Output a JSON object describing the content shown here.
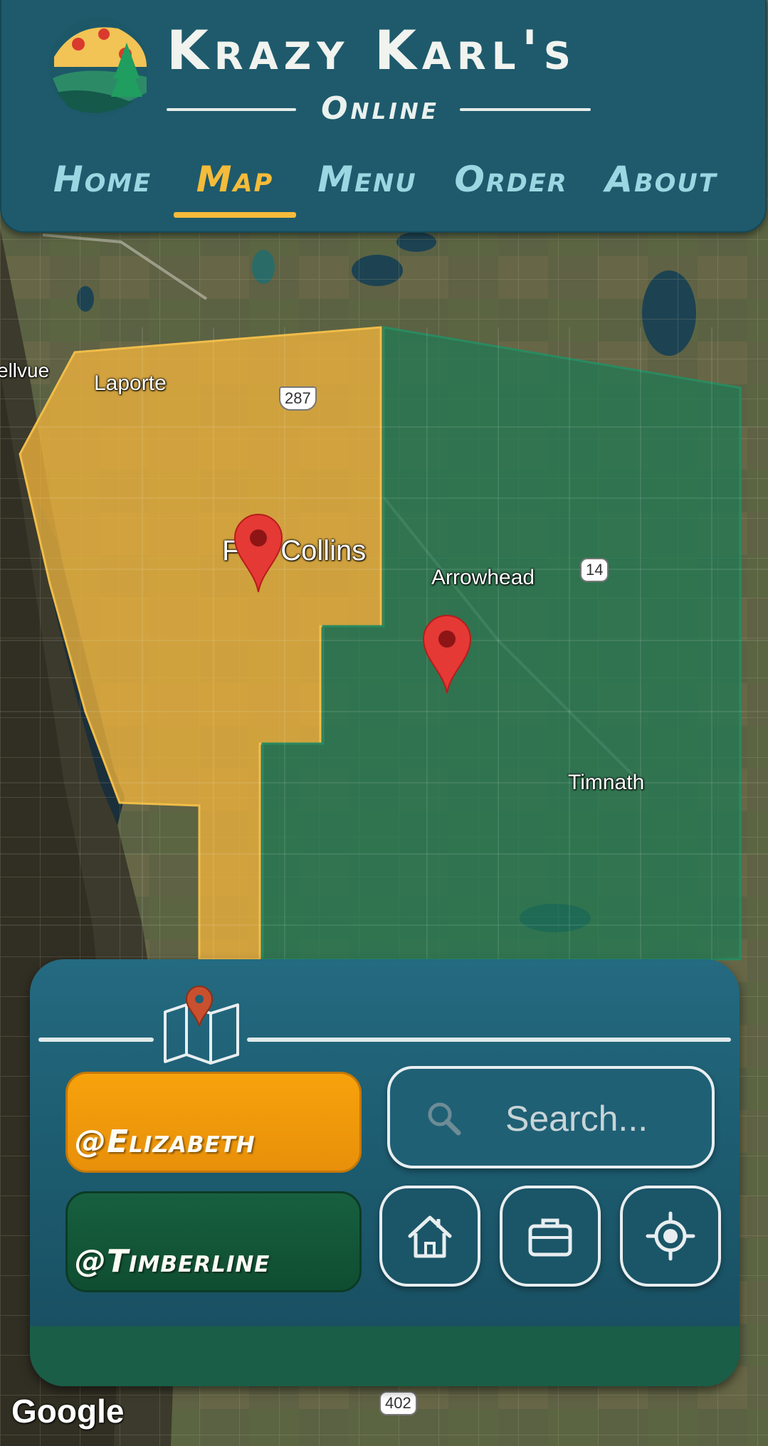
{
  "header": {
    "brand_title": "Krazy Karl's",
    "brand_subtitle": "Online",
    "nav": [
      {
        "label": "Home",
        "active": false
      },
      {
        "label": "Map",
        "active": true
      },
      {
        "label": "Menu",
        "active": false
      },
      {
        "label": "Order",
        "active": false
      },
      {
        "label": "About",
        "active": false
      }
    ]
  },
  "map": {
    "place_labels": [
      "ellvue",
      "Laporte",
      "Fort Collins",
      "Arrowhead",
      "Timnath"
    ],
    "route_shields": [
      "287",
      "14",
      "402"
    ],
    "attribution": "Google",
    "zones": [
      {
        "name": "Elizabeth",
        "color": "#f0b43c"
      },
      {
        "name": "Timberline",
        "color": "#1f7a55"
      }
    ],
    "pin_color": "#e53935"
  },
  "panel": {
    "regions": [
      {
        "label": "@Elizabeth",
        "color": "#f29c10"
      },
      {
        "label": "@Timberline",
        "color": "#125a39"
      }
    ],
    "search": {
      "placeholder": "Search..."
    },
    "actions": [
      {
        "icon": "house-icon"
      },
      {
        "icon": "briefcase-icon"
      },
      {
        "icon": "locate-icon"
      }
    ]
  },
  "theme": {
    "header_bg": "#1e5a6c",
    "nav_text": "#9bd6e2",
    "nav_active": "#f5bb3a",
    "panel_bg": "#1f6075"
  }
}
